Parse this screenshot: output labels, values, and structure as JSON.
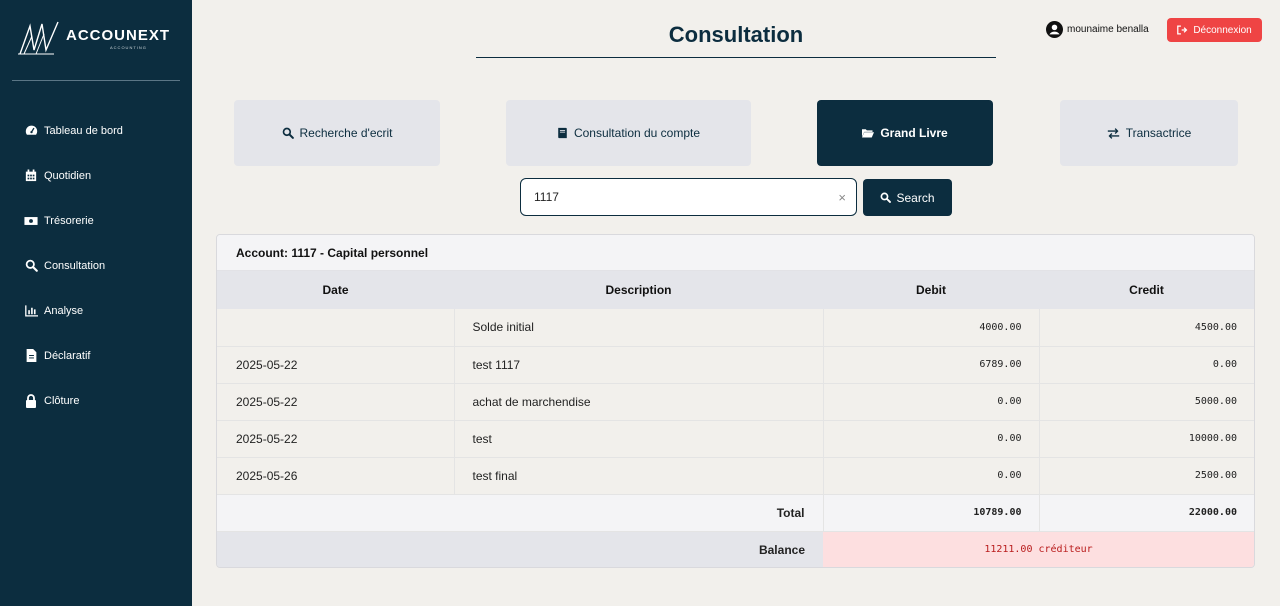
{
  "sidebar": {
    "logo_name": "ACCOUNEXT",
    "logo_sub": "ACCOUNTING",
    "items": [
      {
        "label": "Tableau de bord",
        "icon": "dashboard-icon"
      },
      {
        "label": "Quotidien",
        "icon": "calendar-icon"
      },
      {
        "label": "Trésorerie",
        "icon": "money-icon"
      },
      {
        "label": "Consultation",
        "icon": "search-icon"
      },
      {
        "label": "Analyse",
        "icon": "chart-icon"
      },
      {
        "label": "Déclaratif",
        "icon": "document-icon"
      },
      {
        "label": "Clôture",
        "icon": "lock-icon"
      }
    ]
  },
  "header": {
    "title": "Consultation",
    "user_name": "mounaime benalla",
    "logout_label": "Déconnexion"
  },
  "tabs": [
    {
      "label": "Recherche d'ecrit",
      "icon": "search-icon",
      "active": false
    },
    {
      "label": "Consultation du compte",
      "icon": "book-icon",
      "active": false
    },
    {
      "label": "Grand Livre",
      "icon": "folder-open-icon",
      "active": true
    },
    {
      "label": "Transactrice",
      "icon": "exchange-icon",
      "active": false
    }
  ],
  "search": {
    "value": "1117",
    "clear_label": "×",
    "button_label": "Search"
  },
  "ledger": {
    "account_title": "Account: 1117 - Capital personnel",
    "columns": {
      "date": "Date",
      "description": "Description",
      "debit": "Debit",
      "credit": "Credit"
    },
    "rows": [
      {
        "date": "",
        "description": "Solde initial",
        "debit": "4000.00",
        "credit": "4500.00"
      },
      {
        "date": "2025-05-22",
        "description": "test 1117",
        "debit": "6789.00",
        "credit": "0.00"
      },
      {
        "date": "2025-05-22",
        "description": "achat de marchendise",
        "debit": "0.00",
        "credit": "5000.00"
      },
      {
        "date": "2025-05-22",
        "description": "test",
        "debit": "0.00",
        "credit": "10000.00"
      },
      {
        "date": "2025-05-26",
        "description": "test final",
        "debit": "0.00",
        "credit": "2500.00"
      }
    ],
    "total_label": "Total",
    "total_debit": "10789.00",
    "total_credit": "22000.00",
    "balance_label": "Balance",
    "balance_value": "11211.00 créditeur"
  },
  "colors": {
    "sidebar": "#0c2d3f",
    "accent": "#0c2d3f",
    "logout": "#ef4444",
    "balance_bg": "#fddfe0",
    "balance_text": "#b91c1c"
  }
}
